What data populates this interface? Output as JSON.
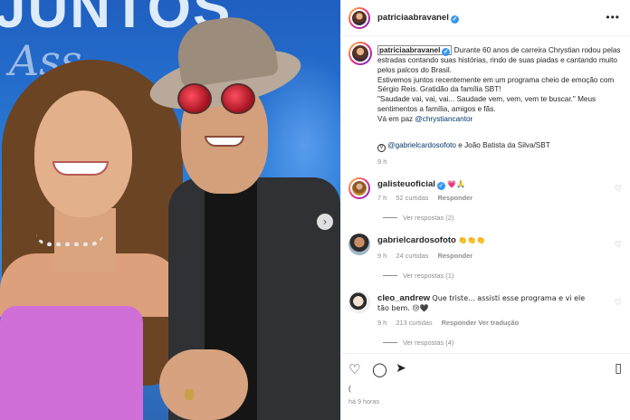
{
  "post": {
    "author": "patriciaabravanel",
    "more_label": "•••",
    "carousel_next_icon": "›",
    "banner_text": "JUNTOS",
    "script_text": "Ass",
    "caption": {
      "username": "patriciaabravanel",
      "line1": " Durante 60 anos de carreira Chrystian rodou pelas estradas contando suas histórias, rindo de suas piadas e cantando muito pelos palcos do Brasil.",
      "line2": "Estivemos juntos recentemente em um programa cheio de emoção com Sérgio Reis. Gratidão da família SBT!",
      "line3": "\"Saudade vai, vai, vai... Saudade vem, vem, vem te buscar.\" Meus sentimentos a família, amigos e fãs.",
      "line4_prefix": "Vá em paz ",
      "mention": "@chrystiancantor"
    },
    "tagline": {
      "mention": "@gabrielcardosofoto",
      "rest": " e João Batista da Silva/SBT"
    },
    "time": "9 h"
  },
  "comments": [
    {
      "username": "galisteuoficial",
      "verified": true,
      "text": "💗🙏",
      "time": "7 h",
      "likes": "52 curtidas",
      "reply": "Responder",
      "replies": "Ver respostas (2)"
    },
    {
      "username": "gabrielcardosofoto",
      "verified": false,
      "text": "👏👏👏",
      "time": "9 h",
      "likes": "24 curtidas",
      "reply": "Responder",
      "replies": "Ver respostas (1)"
    },
    {
      "username": "cleo_andrew",
      "verified": false,
      "text": "Que triste... assisti esse programa e vi ele tão bem. 😢🖤",
      "time": "9 h",
      "likes": "213 curtidas",
      "reply": "Responder",
      "translate": "Ver tradução",
      "replies": "Ver respostas (4)"
    }
  ],
  "actions": {
    "like_icon": "♡",
    "comment_icon": "◯",
    "share_icon": "➤",
    "save_icon": "▯",
    "likes_text": "(",
    "post_time": "há 9 horas"
  },
  "colors": {
    "link": "#00376b",
    "verified": "#3897f0",
    "muted": "#8e8e8e"
  }
}
